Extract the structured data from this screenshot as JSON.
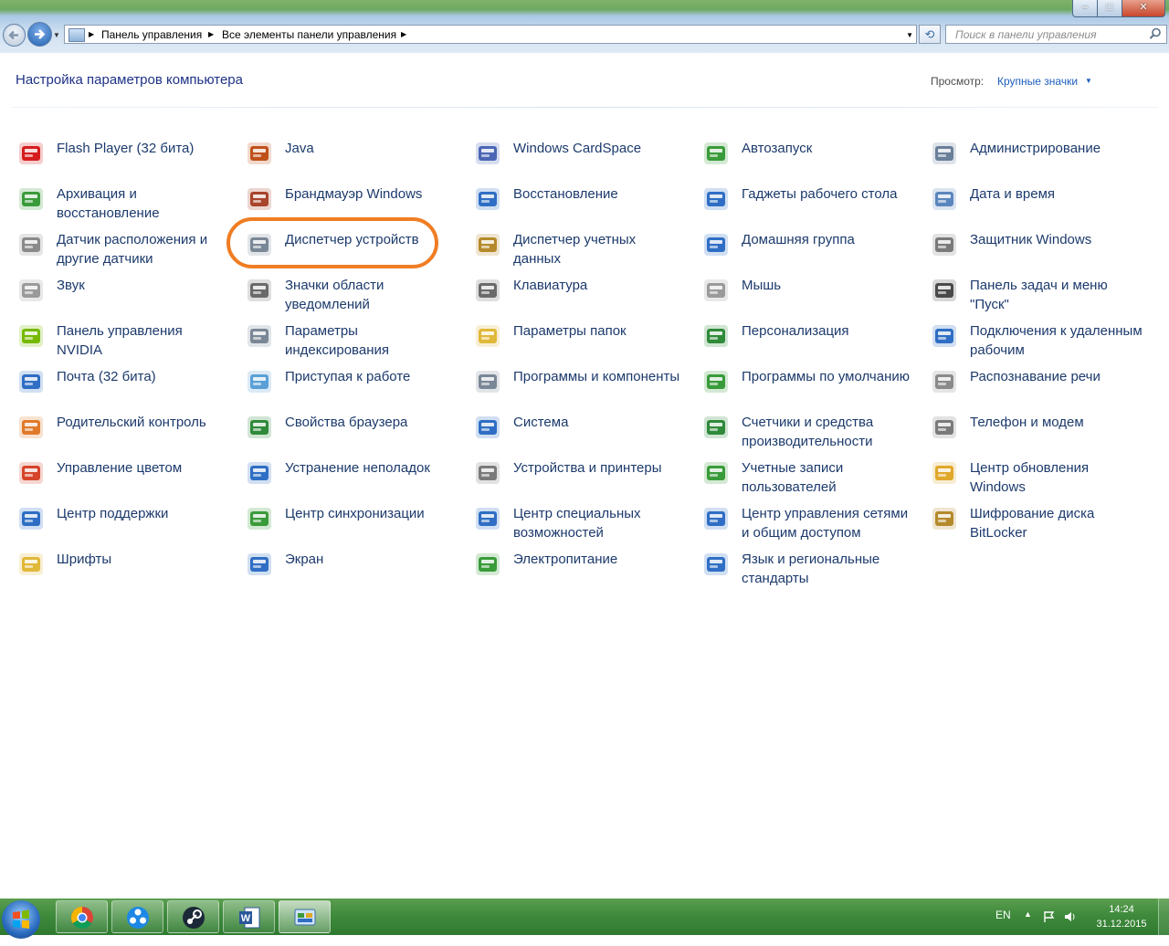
{
  "window": {
    "min_label": "–",
    "max_label": "□",
    "close_label": "✕"
  },
  "address_bar": {
    "crumbs": [
      "Панель управления",
      "Все элементы панели управления"
    ]
  },
  "search": {
    "placeholder": "Поиск в панели управления"
  },
  "header": {
    "title": "Настройка параметров компьютера",
    "view_label": "Просмотр:",
    "view_value": "Крупные значки"
  },
  "items": [
    {
      "label": "Flash Player (32 бита)",
      "icon": "flash-icon",
      "color": "#d61c1c"
    },
    {
      "label": "Java",
      "icon": "java-icon",
      "color": "#c0501a"
    },
    {
      "label": "Windows CardSpace",
      "icon": "cardspace-icon",
      "color": "#4a66b4"
    },
    {
      "label": "Автозапуск",
      "icon": "autoplay-icon",
      "color": "#3a9b3a"
    },
    {
      "label": "Администрирование",
      "icon": "admin-tools-icon",
      "color": "#6a7f99"
    },
    {
      "label": "Архивация и восстановление",
      "icon": "backup-icon",
      "color": "#3a9b3a"
    },
    {
      "label": "Брандмауэр Windows",
      "icon": "firewall-icon",
      "color": "#a8442a"
    },
    {
      "label": "Восстановление",
      "icon": "recovery-icon",
      "color": "#2f6ec4"
    },
    {
      "label": "Гаджеты рабочего стола",
      "icon": "gadgets-icon",
      "color": "#2f6ec4"
    },
    {
      "label": "Дата и время",
      "icon": "date-time-icon",
      "color": "#5b86bd"
    },
    {
      "label": "Датчик расположения и другие датчики",
      "icon": "sensor-icon",
      "color": "#8a8a8a"
    },
    {
      "label": "Диспетчер устройств",
      "icon": "device-manager-icon",
      "color": "#7a8796"
    },
    {
      "label": "Диспетчер учетных данных",
      "icon": "credential-icon",
      "color": "#b58a2c"
    },
    {
      "label": "Домашняя группа",
      "icon": "homegroup-icon",
      "color": "#2f6ec4"
    },
    {
      "label": "Защитник Windows",
      "icon": "defender-icon",
      "color": "#7a7a7a"
    },
    {
      "label": "Звук",
      "icon": "sound-icon",
      "color": "#9a9a9a"
    },
    {
      "label": "Значки области уведомлений",
      "icon": "notification-icons-icon",
      "color": "#6a6a6a"
    },
    {
      "label": "Клавиатура",
      "icon": "keyboard-icon",
      "color": "#6a6a6a"
    },
    {
      "label": "Мышь",
      "icon": "mouse-icon",
      "color": "#9a9a9a"
    },
    {
      "label": "Панель задач и меню \"Пуск\"",
      "icon": "taskbar-icon",
      "color": "#4a4a4a"
    },
    {
      "label": "Панель управления NVIDIA",
      "icon": "nvidia-icon",
      "color": "#76b900"
    },
    {
      "label": "Параметры индексирования",
      "icon": "indexing-icon",
      "color": "#7a8796"
    },
    {
      "label": "Параметры папок",
      "icon": "folder-options-icon",
      "color": "#e0b83a"
    },
    {
      "label": "Персонализация",
      "icon": "personalization-icon",
      "color": "#2f8a3a"
    },
    {
      "label": "Подключения к удаленным рабочим",
      "icon": "remote-desktop-icon",
      "color": "#2f6ec4"
    },
    {
      "label": "Почта (32 бита)",
      "icon": "mail-icon",
      "color": "#2f6ec4"
    },
    {
      "label": "Приступая к работе",
      "icon": "getting-started-icon",
      "color": "#5aa0d6"
    },
    {
      "label": "Программы и компоненты",
      "icon": "programs-icon",
      "color": "#7a8796"
    },
    {
      "label": "Программы по умолчанию",
      "icon": "default-programs-icon",
      "color": "#3a9b3a"
    },
    {
      "label": "Распознавание речи",
      "icon": "microphone-icon",
      "color": "#8a8a8a"
    },
    {
      "label": "Родительский контроль",
      "icon": "parental-controls-icon",
      "color": "#e07a2a"
    },
    {
      "label": "Свойства браузера",
      "icon": "internet-options-icon",
      "color": "#2f8a3a"
    },
    {
      "label": "Система",
      "icon": "system-icon",
      "color": "#2f6ec4"
    },
    {
      "label": "Счетчики и средства производительности",
      "icon": "performance-icon",
      "color": "#2f8a3a"
    },
    {
      "label": "Телефон и модем",
      "icon": "phone-modem-icon",
      "color": "#7a7a7a"
    },
    {
      "label": "Управление цветом",
      "icon": "color-management-icon",
      "color": "#d6442a"
    },
    {
      "label": "Устранение неполадок",
      "icon": "troubleshooting-icon",
      "color": "#2f6ec4"
    },
    {
      "label": "Устройства и принтеры",
      "icon": "printer-icon",
      "color": "#7a7a7a"
    },
    {
      "label": "Учетные записи пользователей",
      "icon": "user-accounts-icon",
      "color": "#3a9b3a"
    },
    {
      "label": "Центр обновления Windows",
      "icon": "windows-update-icon",
      "color": "#e0a82a"
    },
    {
      "label": "Центр поддержки",
      "icon": "action-center-flag-icon",
      "color": "#2f6ec4"
    },
    {
      "label": "Центр синхронизации",
      "icon": "sync-center-icon",
      "color": "#3a9b3a"
    },
    {
      "label": "Центр специальных возможностей",
      "icon": "accessibility-icon",
      "color": "#2f6ec4"
    },
    {
      "label": "Центр управления сетями и общим доступом",
      "icon": "network-center-icon",
      "color": "#2f6ec4"
    },
    {
      "label": "Шифрование диска BitLocker",
      "icon": "bitlocker-icon",
      "color": "#b58a2c"
    },
    {
      "label": "Шрифты",
      "icon": "fonts-icon",
      "color": "#e0b83a"
    },
    {
      "label": "Экран",
      "icon": "display-icon",
      "color": "#2f6ec4"
    },
    {
      "label": "Электропитание",
      "icon": "power-options-icon",
      "color": "#3a9b3a"
    },
    {
      "label": "Язык и региональные стандарты",
      "icon": "region-language-icon",
      "color": "#2f6ec4"
    }
  ],
  "taskbar": {
    "apps": [
      {
        "name": "chrome-icon"
      },
      {
        "name": "app-circles-icon"
      },
      {
        "name": "steam-icon"
      },
      {
        "name": "word-icon"
      },
      {
        "name": "control-panel-icon"
      }
    ],
    "language": "EN",
    "time": "14:24",
    "date": "31.12.2015"
  }
}
